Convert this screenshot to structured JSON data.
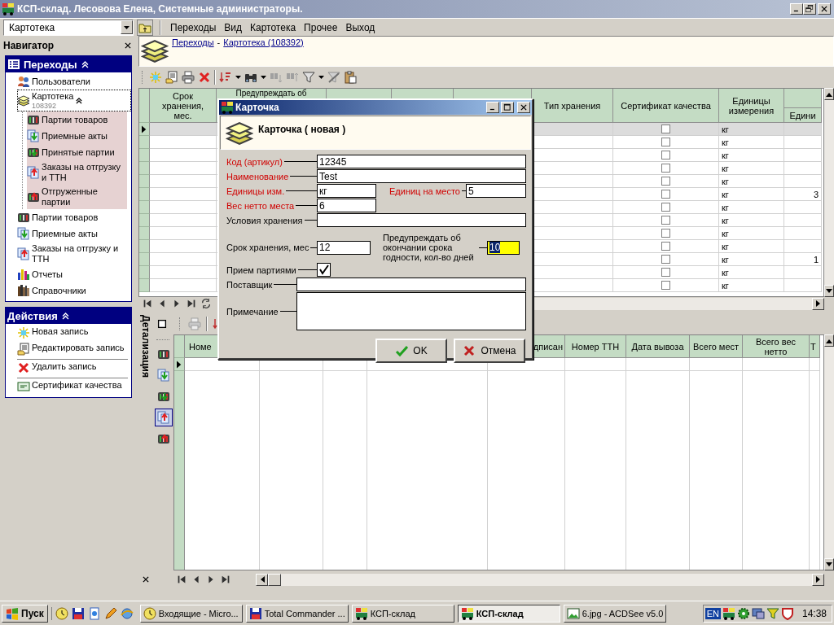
{
  "window": {
    "title": "КСП-склад. Лесовова Елена, Системные администраторы."
  },
  "menubar": {
    "view": "Картотека",
    "menus": [
      "Переходы",
      "Вид",
      "Картотека",
      "Прочее",
      "Выход"
    ]
  },
  "navigator": {
    "title": "Навигатор",
    "panels": [
      {
        "title": "Переходы",
        "expanded": true,
        "items": [
          {
            "label": "Пользователи",
            "selected": false
          },
          {
            "label": "Картотека",
            "count": "108392",
            "selected": true,
            "expanded": true,
            "children": [
              {
                "label": "Партии товаров",
                "selected": false
              },
              {
                "label": "Приемные акты",
                "selected": false
              },
              {
                "label": "Принятые партии",
                "selected": false
              },
              {
                "label": "Заказы на отгрузку и ТТН",
                "selected": false
              },
              {
                "label": "Отгруженные партии",
                "selected": false
              }
            ]
          },
          {
            "label": "Партии товаров",
            "selected": false
          },
          {
            "label": "Приемные акты",
            "selected": false
          },
          {
            "label": "Заказы на отгрузку и ТТН",
            "selected": false
          },
          {
            "label": "Отчеты",
            "selected": false
          },
          {
            "label": "Справочники",
            "selected": false
          }
        ]
      },
      {
        "title": "Действия",
        "expanded": true,
        "items": [
          {
            "label": "Новая запись",
            "divider_before": false
          },
          {
            "label": "Редактировать запись",
            "divider_before": false
          },
          {
            "label": "Удалить запись",
            "divider_before": true
          },
          {
            "label": "Сертификат качества",
            "divider_before": true
          }
        ]
      }
    ]
  },
  "breadcrumb": {
    "links": [
      "Переходы",
      "Картотека (108392)"
    ],
    "separator": "-"
  },
  "top_grid": {
    "columns": [
      "Срок хранения, мес.",
      "Предупреждать об",
      "Тип хранения",
      "Сертификат качества",
      "Единицы измерения",
      "Едини"
    ],
    "rows": [
      {
        "selected": true,
        "certified": false,
        "unit": "кг"
      },
      {
        "selected": false,
        "certified": false,
        "unit": "кг"
      },
      {
        "selected": false,
        "certified": false,
        "unit": "кг"
      },
      {
        "selected": false,
        "certified": false,
        "unit": "кг"
      },
      {
        "selected": false,
        "certified": false,
        "unit": "кг"
      },
      {
        "selected": false,
        "certified": false,
        "unit": "кг",
        "last_column": "3"
      },
      {
        "selected": false,
        "certified": false,
        "unit": "кг"
      },
      {
        "selected": false,
        "certified": false,
        "unit": "кг"
      },
      {
        "selected": false,
        "certified": false,
        "unit": "кг"
      },
      {
        "selected": false,
        "certified": false,
        "unit": "кг"
      },
      {
        "selected": false,
        "certified": false,
        "unit": "кг",
        "last_column": "1"
      },
      {
        "selected": false,
        "certified": false,
        "unit": "кг"
      },
      {
        "selected": false,
        "certified": false,
        "unit": "кг"
      }
    ]
  },
  "detail": {
    "title": "Детализация",
    "tabs": [
      {
        "selected": false
      },
      {
        "selected": false
      },
      {
        "selected": false
      },
      {
        "selected": true
      },
      {
        "selected": false
      }
    ]
  },
  "bottom_grid": {
    "columns": [
      "Номе",
      "дписан",
      "Номер ТТН",
      "Дата вывоза",
      "Всего мест",
      "Всего вес нетто",
      "Т"
    ]
  },
  "dialog": {
    "title": "Карточка",
    "heading": "Карточка ( новая )",
    "rows": [
      [
        {
          "kind": "text",
          "label": "Код (артикул)",
          "required": true,
          "value": "12345",
          "focused": false
        }
      ],
      [
        {
          "kind": "text",
          "label": "Наименование",
          "required": true,
          "value": "Test",
          "focused": false
        }
      ],
      [
        {
          "kind": "text",
          "label": "Единицы изм.",
          "required": true,
          "value": "кг",
          "focused": false
        },
        {
          "kind": "text",
          "label": "Единиц на место",
          "required": true,
          "value": "5",
          "focused": false
        }
      ],
      [
        {
          "kind": "text",
          "label": "Вес нетто места",
          "required": true,
          "value": "6",
          "focused": false
        }
      ],
      [
        {
          "kind": "text",
          "label": "Условия хранения",
          "required": false,
          "focused": false
        }
      ],
      [
        {
          "kind": "text",
          "label": "Срок хранения, мес",
          "required": false,
          "value": "12",
          "focused": false
        },
        {
          "kind": "text",
          "label": "Предупреждать об окончании срока годности, кол-во дней",
          "required": false,
          "value": "10",
          "focused": true
        }
      ],
      [
        {
          "kind": "checkbox",
          "label": "Прием партиями",
          "required": false,
          "checked": true
        }
      ],
      [
        {
          "kind": "text",
          "label": "Поставщик",
          "required": false,
          "focused": false
        }
      ],
      [
        {
          "kind": "memo",
          "label": "Примечание",
          "required": false,
          "focused": false
        }
      ]
    ],
    "buttons": [
      {
        "kind": "ok",
        "label": "OK"
      },
      {
        "kind": "cancel",
        "label": "Отмена"
      }
    ]
  },
  "taskbar": {
    "start": "Пуск",
    "tasks": [
      {
        "label": "Входящие - Micro...",
        "selected": false
      },
      {
        "label": "Total Commander ...",
        "selected": false
      },
      {
        "label": "КСП-склад",
        "selected": false
      },
      {
        "label": "КСП-склад",
        "selected": true
      },
      {
        "label": "6.jpg - ACDSee v5.0",
        "selected": false
      }
    ],
    "language": "EN",
    "clock": "14:38"
  }
}
